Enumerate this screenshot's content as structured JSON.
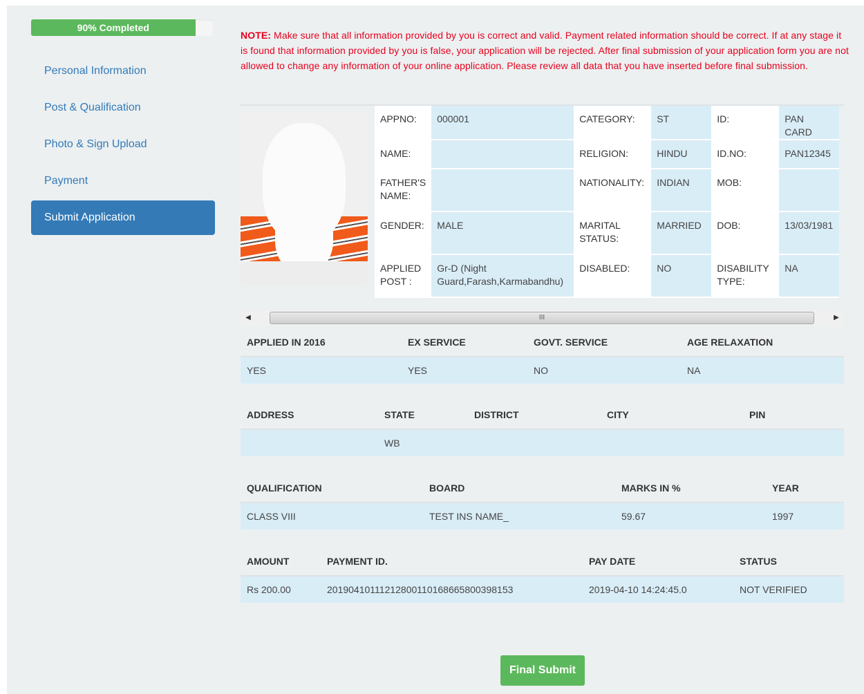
{
  "sidebar": {
    "progress_label": "90% Completed",
    "progress_value": 0.9,
    "items": [
      {
        "label": "Personal Information"
      },
      {
        "label": "Post & Qualification"
      },
      {
        "label": "Photo & Sign Upload"
      },
      {
        "label": "Payment"
      },
      {
        "label": "Submit Application"
      }
    ]
  },
  "note": {
    "prefix": "NOTE:",
    "text": " Make sure that all information provided by you is correct and valid. Payment related information should be correct. If at any stage it is found that information provided by you is false, your application will be rejected. After final submission of your application form you are not allowed to change any information of your online application. Please review all data that you have inserted before final submission."
  },
  "profile": {
    "appno_label": "APPNO:",
    "appno": "000001",
    "category_label": "CATEGORY:",
    "category": "ST",
    "id_label": "ID:",
    "id": "PAN CARD",
    "name_label": "NAME:",
    "name": "",
    "religion_label": "RELIGION:",
    "religion": "HINDU",
    "idno_label": "ID.NO:",
    "idno": "PAN12345",
    "father_label": "FATHER'S NAME:",
    "father": "",
    "nationality_label": "NATIONALITY:",
    "nationality": "INDIAN",
    "mob_label": "MOB:",
    "mob": "",
    "gender_label": "GENDER:",
    "gender": "MALE",
    "marital_label": "MARITAL STATUS:",
    "marital": "MARRIED",
    "dob_label": "DOB:",
    "dob": "13/03/1981",
    "post_label": "APPLIED POST :",
    "post": "Gr-D (Night Guard,Farash,Karmabandhu)",
    "disabled_label": "DISABLED:",
    "disabled": "NO",
    "distype_label": "DISABILITY TYPE:",
    "distype": "NA"
  },
  "scrollbar": {
    "left_arrow": "◀",
    "right_arrow": "▶",
    "grip": "III"
  },
  "service": {
    "headers": [
      "APPLIED IN 2016",
      "EX SERVICE",
      "GOVT. SERVICE",
      "AGE RELAXATION"
    ],
    "row": [
      "YES",
      "YES",
      "NO",
      "NA"
    ]
  },
  "address": {
    "headers": [
      "ADDRESS",
      "STATE",
      "DISTRICT",
      "CITY",
      "PIN"
    ],
    "row": [
      "",
      "WB",
      "",
      "",
      ""
    ]
  },
  "qualification": {
    "headers": [
      "QUALIFICATION",
      "BOARD",
      "MARKS IN %",
      "YEAR"
    ],
    "row": [
      "CLASS VIII",
      "TEST INS NAME_",
      "59.67",
      "1997"
    ]
  },
  "payment": {
    "headers": [
      "AMOUNT",
      "PAYMENT ID.",
      "PAY DATE",
      "STATUS"
    ],
    "row": [
      "Rs 200.00",
      "20190410111212800110168665800398153",
      "2019-04-10 14:24:45.0",
      "NOT VERIFIED"
    ]
  },
  "final_submit_label": "Final Submit"
}
